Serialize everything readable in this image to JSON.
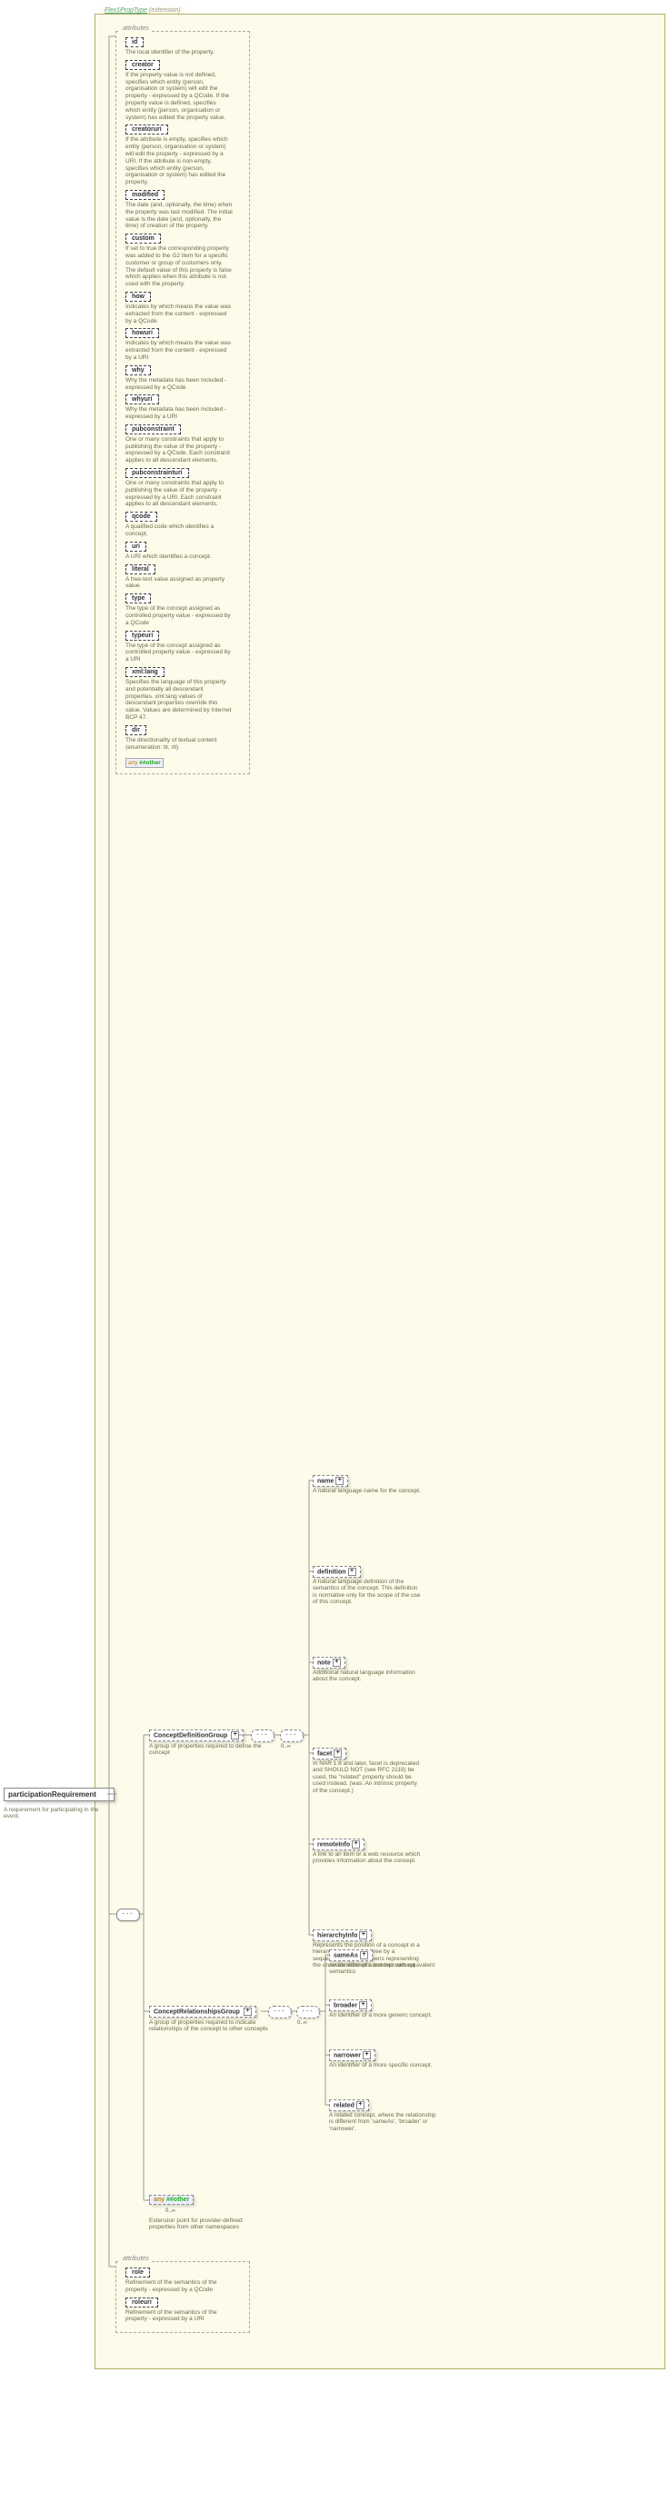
{
  "extension_label_prefix": "Flex1PropType",
  "extension_label_suffix": " (extension)",
  "root": {
    "name": "participationRequirement",
    "desc": "A requirement for participating in the event."
  },
  "attr_header": "attributes",
  "any_key": "any",
  "any_val": "##other",
  "occur_multi": "0..∞",
  "attrs1": [
    {
      "name": "id",
      "desc": "The local identifier of the property."
    },
    {
      "name": "creator",
      "desc": "If the property value is not defined, specifies which entity (person, organisation or system) will edit the property - expressed by a QCode. If the property value is defined, specifies which entity (person, organisation or system) has edited the property value."
    },
    {
      "name": "creatoruri",
      "desc": "If the attribute is empty, specifies which entity (person, organisation or system) will edit the property - expressed by a URI. If the attribute is non-empty, specifies which entity (person, organisation or system) has edited the property."
    },
    {
      "name": "modified",
      "desc": "The date (and, optionally, the time) when the property was last modified. The initial value is the date (and, optionally, the time) of creation of the property."
    },
    {
      "name": "custom",
      "desc": "If set to true the corresponding property was added to the G2 Item for a specific customer or group of customers only. The default value of this property is false which applies when this attribute is not used with the property."
    },
    {
      "name": "how",
      "desc": "Indicates by which means the value was extracted from the content - expressed by a QCode"
    },
    {
      "name": "howuri",
      "desc": "Indicates by which means the value was extracted from the content - expressed by a URI"
    },
    {
      "name": "why",
      "desc": "Why the metadata has been included - expressed by a QCode"
    },
    {
      "name": "whyuri",
      "desc": "Why the metadata has been included - expressed by a URI"
    },
    {
      "name": "pubconstraint",
      "desc": "One or many constraints that apply to publishing the value of the property - expressed by a QCode. Each constraint applies to all descendant elements."
    },
    {
      "name": "pubconstrainturi",
      "desc": "One or many constraints that apply to publishing the value of the property - expressed by a URI. Each constraint applies to all descendant elements."
    },
    {
      "name": "qcode",
      "desc": "A qualified code which identifies a concept."
    },
    {
      "name": "uri",
      "desc": "A URI which identifies a concept."
    },
    {
      "name": "literal",
      "desc": "A free-text value assigned as property value."
    },
    {
      "name": "type",
      "desc": "The type of the concept assigned as controlled property value - expressed by a QCode"
    },
    {
      "name": "typeuri",
      "desc": "The type of the concept assigned as controlled property value - expressed by a URI"
    },
    {
      "name": "xml:lang",
      "desc": "Specifies the language of this property and potentially all descendant properties. xml:lang values of descendant properties override this value. Values are determined by Internet BCP 47."
    },
    {
      "name": "dir",
      "desc": "The directionality of textual content (enumeration: ltr, rtl)"
    }
  ],
  "group1": {
    "name": "ConceptDefinitionGroup",
    "desc": "A group of properties required to define the concept"
  },
  "group1_children": [
    {
      "name": "name",
      "desc": "A natural language name for the concept."
    },
    {
      "name": "definition",
      "desc": "A natural language definition of the semantics of the concept. This definition is normative only for the scope of the use of this concept."
    },
    {
      "name": "note",
      "desc": "Additional natural language information about the concept."
    },
    {
      "name": "facet",
      "desc": "In NAR 1.8 and later, facet is deprecated and SHOULD NOT (see RFC 2119) be used, the \"related\" property should be used instead. (was: An intrinsic property of the concept.)"
    },
    {
      "name": "remoteInfo",
      "desc": "A link to an item or a web resource which provides information about the concept."
    },
    {
      "name": "hierarchyInfo",
      "desc": "Represents the position of a concept in a hierarchical taxonomy tree by a sequence of QCode tokens representing the ancestor concepts and this concept"
    }
  ],
  "group2": {
    "name": "ConceptRelationshipsGroup",
    "desc": "A group of properties required to indicate relationships of the concept to other concepts"
  },
  "group2_children": [
    {
      "name": "sameAs",
      "desc": "An identifier of a concept with equivalent semantics"
    },
    {
      "name": "broader",
      "desc": "An identifier of a more generic concept."
    },
    {
      "name": "narrower",
      "desc": "An identifier of a more specific concept."
    },
    {
      "name": "related",
      "desc": "A related concept, where the relationship is different from 'sameAs', 'broader' or 'narrower'."
    }
  ],
  "any_elem_desc": "Extension point for provider-defined properties from other namespaces",
  "attrs2": [
    {
      "name": "role",
      "desc": "Refinement of the semantics of the property - expressed by a QCode"
    },
    {
      "name": "roleuri",
      "desc": "Refinement of the semantics of the property - expressed by a URI"
    }
  ]
}
